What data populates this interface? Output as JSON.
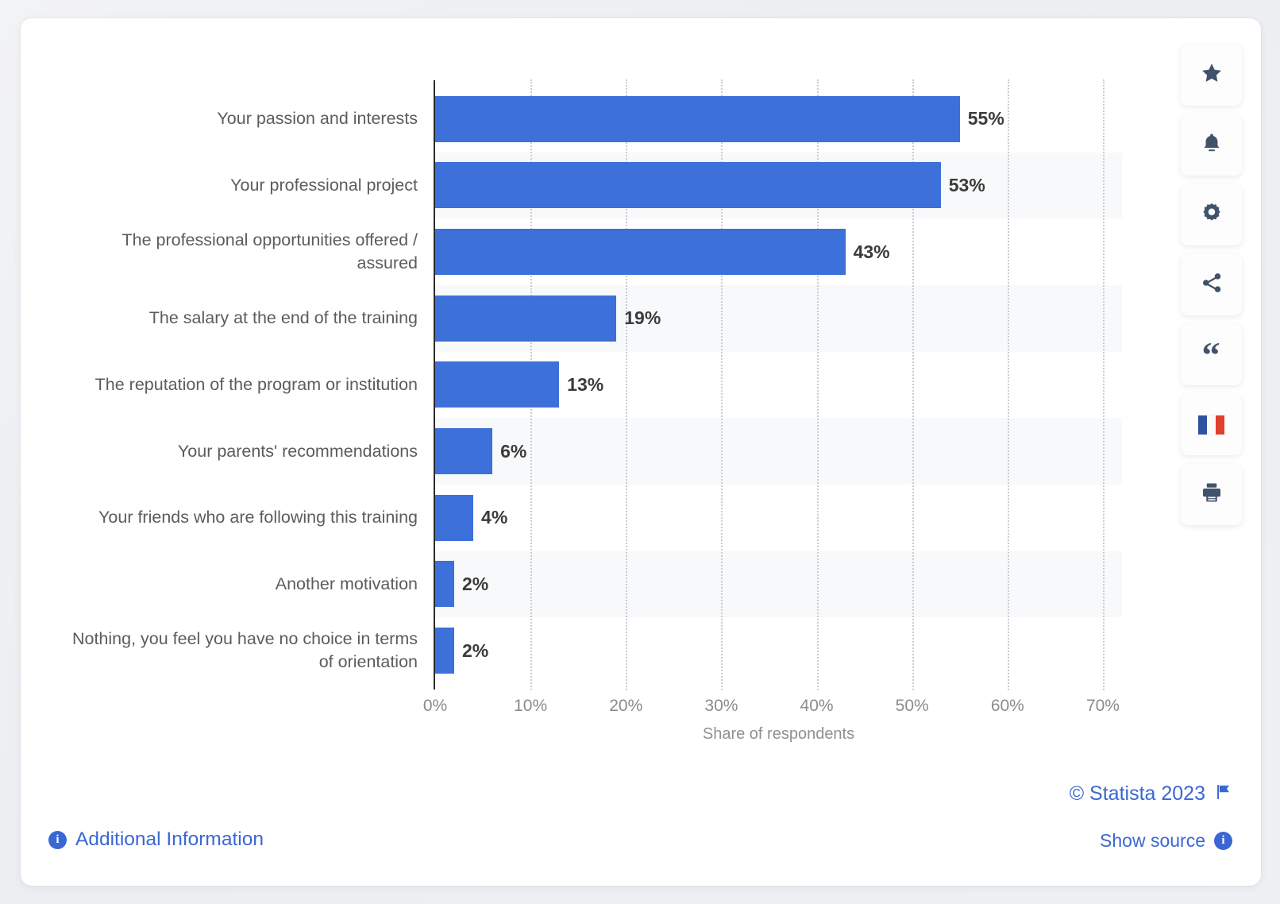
{
  "chart_data": {
    "type": "bar",
    "orientation": "horizontal",
    "title": "",
    "xlabel": "Share of respondents",
    "ylabel": "",
    "xlim": [
      0,
      72
    ],
    "grid": true,
    "legend": null,
    "xticks": [
      "0%",
      "10%",
      "20%",
      "30%",
      "40%",
      "50%",
      "60%",
      "70%"
    ],
    "xtick_values": [
      0,
      10,
      20,
      30,
      40,
      50,
      60,
      70
    ],
    "categories": [
      "Your passion and interests",
      "Your professional project",
      "The professional opportunities offered / assured",
      "The salary at the end of the training",
      "The reputation of the program or institution",
      "Your parents' recommendations",
      "Your friends who are following this training",
      "Another motivation",
      "Nothing, you feel you have no choice in terms of orientation"
    ],
    "values": [
      55,
      53,
      43,
      19,
      13,
      6,
      4,
      2,
      2
    ],
    "value_labels": [
      "55%",
      "53%",
      "43%",
      "19%",
      "13%",
      "6%",
      "4%",
      "2%",
      "2%"
    ],
    "bar_color": "#3d70d8"
  },
  "toolbar": {
    "items": [
      {
        "icon": "star-icon",
        "name": "favorite-button"
      },
      {
        "icon": "bell-icon",
        "name": "notification-button"
      },
      {
        "icon": "gear-icon",
        "name": "settings-button"
      },
      {
        "icon": "share-icon",
        "name": "share-button"
      },
      {
        "icon": "quote-icon",
        "name": "citation-button"
      },
      {
        "icon": "french-flag-icon",
        "name": "language-button"
      },
      {
        "icon": "printer-icon",
        "name": "print-button"
      }
    ]
  },
  "footer": {
    "additional_information": "Additional Information",
    "copyright": "© Statista 2023",
    "show_source": "Show source"
  },
  "colors": {
    "bar": "#3d70d8",
    "link": "#3a67d4",
    "axis_text": "#8b8b8b",
    "category_text": "#5c5c5c",
    "value_text": "#3b3b3b"
  }
}
